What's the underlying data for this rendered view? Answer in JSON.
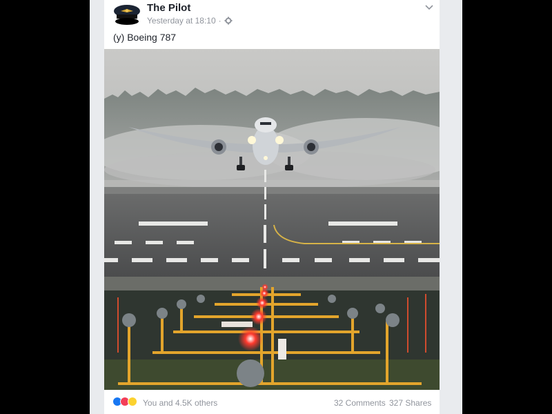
{
  "post": {
    "author": "The Pilot",
    "timestamp": "Yesterday at 18:10",
    "separator": "·",
    "caption": "(y) Boeing 787",
    "menu_icon": "chevron-down-icon",
    "privacy_icon": "gear-icon",
    "avatar_icon": "pilot-cap-avatar"
  },
  "engagement": {
    "reactions": [
      "like-icon",
      "love-icon",
      "wow-icon"
    ],
    "reactions_text": "You and 4.5K others",
    "comments": "32 Comments",
    "shares": "327 Shares"
  },
  "colors": {
    "page_bg": "#000000",
    "gutter": "#e9ebee",
    "card": "#ffffff",
    "text": "#1d2129",
    "muted": "#90949c",
    "like": "#1877f2",
    "love": "#f33e58",
    "wow": "#fcd22f"
  }
}
